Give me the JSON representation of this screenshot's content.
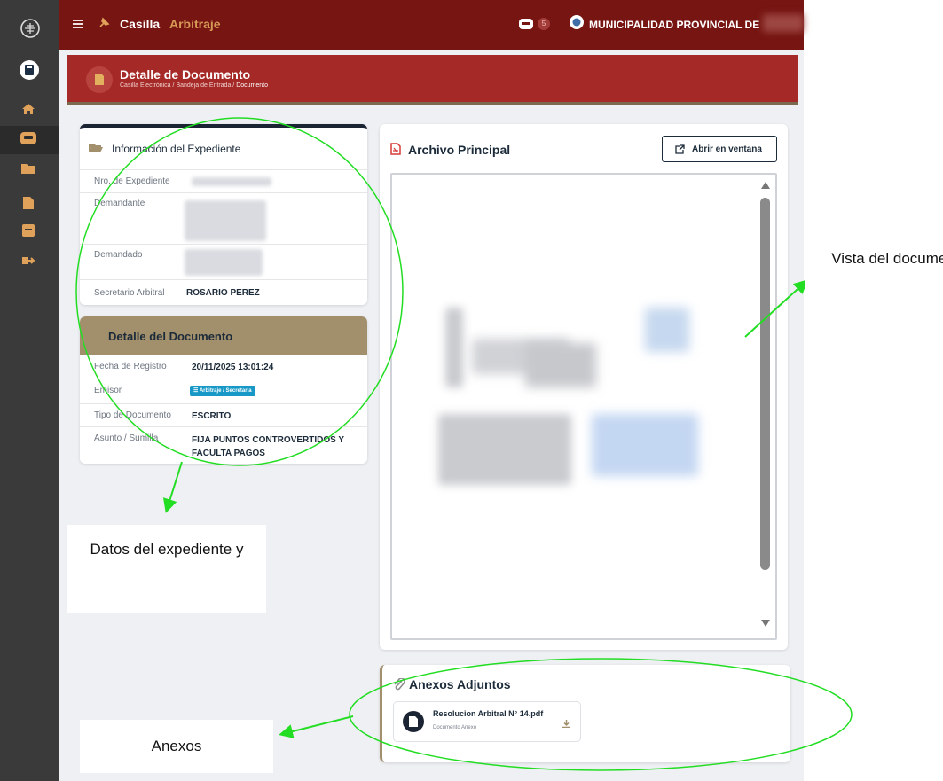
{
  "topbar": {
    "app_name_bold": "Casilla",
    "app_name_light": "Arbitraje",
    "notification_count": "5",
    "organization": "MUNICIPALIDAD PROVINCIAL DE"
  },
  "banner": {
    "title": "Detalle de Documento",
    "breadcrumb": {
      "item1": "Casilla Electrónica",
      "sep1": "/",
      "item2": "Bandeja de Entrada",
      "sep2": "/",
      "item3": "Documento"
    }
  },
  "expediente": {
    "title": "Información del Expediente",
    "rows": [
      {
        "label": "Nro. de Expediente",
        "value": ""
      },
      {
        "label": "Demandante",
        "value": ""
      },
      {
        "label": "Demandado",
        "value": ""
      },
      {
        "label": "Secretario Arbitral",
        "value": "ROSARIO PEREZ"
      }
    ]
  },
  "documento": {
    "title": "Detalle del Documento",
    "rows": [
      {
        "label": "Fecha de Registro",
        "value": "20/11/2025 13:01:24"
      },
      {
        "label": "Emisor",
        "value": "Arbitraje / Secretaria"
      },
      {
        "label": "Tipo de Documento",
        "value": "ESCRITO"
      },
      {
        "label": "Asunto / Sumilla",
        "value": "FIJA PUNTOS CONTROVERTIDOS Y FACULTA PAGOS"
      }
    ]
  },
  "archivo": {
    "title": "Archivo Principal",
    "open_button": "Abrir en ventana"
  },
  "anexos": {
    "title": "Anexos Adjuntos",
    "file_name": "Resolucion Arbitral N° 14.pdf",
    "file_type": "Documento Anexo"
  },
  "annotations": {
    "datos": "Datos del expediente y",
    "vista": "Vista del documento",
    "anexos": "Anexos"
  },
  "colors": {
    "topbar": "#761512",
    "banner": "#a52927",
    "accent_gold": "#a28f6c",
    "sidebar": "#3a3a3a",
    "annotation_green": "#22dd22"
  },
  "icons": {
    "sidebar": [
      "logo-icon",
      "avatar-icon",
      "home-icon",
      "inbox-icon",
      "folder-icon",
      "file-icon",
      "archive-icon",
      "logout-icon"
    ],
    "top": [
      "menu-icon",
      "pin-icon",
      "inbox-icon",
      "org-logo-icon"
    ]
  }
}
